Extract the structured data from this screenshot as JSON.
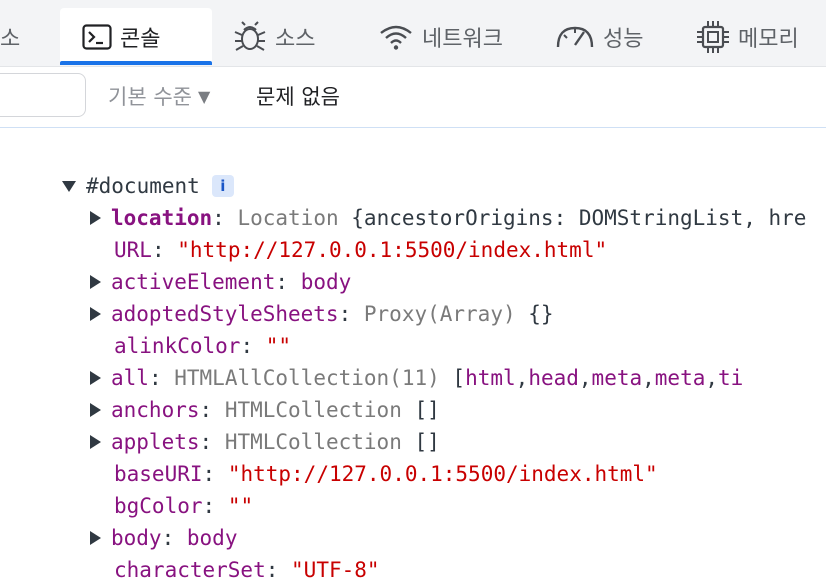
{
  "tabs": [
    {
      "label": "소",
      "icon": "sources-icon"
    },
    {
      "label": "콘솔",
      "icon": "console-icon",
      "active": true
    },
    {
      "label": "소스",
      "icon": "bug-icon"
    },
    {
      "label": "네트워크",
      "icon": "wifi-icon"
    },
    {
      "label": "성능",
      "icon": "gauge-icon"
    },
    {
      "label": "메모리",
      "icon": "chip-icon"
    }
  ],
  "filter": {
    "input_value": "",
    "level_label": "기본 수준",
    "level_caret": "▼",
    "issues_label": "문제 없음"
  },
  "tree": {
    "root": {
      "label": "#document",
      "info": "i"
    },
    "rows": [
      {
        "key": "location",
        "sep": ":",
        "type": "Location",
        "value": "{ancestorOrigins: DOMStringList, hre"
      },
      {
        "key": "URL",
        "sep": ":",
        "string": "\"http://127.0.0.1:5500/index.html\""
      },
      {
        "key": "activeElement",
        "sep": ":",
        "value": "body"
      },
      {
        "key": "adoptedStyleSheets",
        "sep": ":",
        "type": "Proxy(Array)",
        "value": "{}"
      },
      {
        "key": "alinkColor",
        "sep": ":",
        "string": "\"\""
      },
      {
        "key": "all",
        "sep": ":",
        "type": "HTMLAllCollection(11)",
        "open": "[",
        "items": [
          "html",
          "head",
          "meta",
          "meta",
          "ti"
        ]
      },
      {
        "key": "anchors",
        "sep": ":",
        "type": "HTMLCollection",
        "value": "[]"
      },
      {
        "key": "applets",
        "sep": ":",
        "type": "HTMLCollection",
        "value": "[]"
      },
      {
        "key": "baseURI",
        "sep": ":",
        "string": "\"http://127.0.0.1:5500/index.html\""
      },
      {
        "key": "bgColor",
        "sep": ":",
        "string": "\"\""
      },
      {
        "key": "body",
        "sep": ":",
        "value": "body"
      },
      {
        "key": "characterSet",
        "sep": ":",
        "string": "\"UTF-8\""
      }
    ],
    "list_sep": ", "
  },
  "colors": {
    "accent": "#1a73e8",
    "key": "#881280",
    "string": "#c80000",
    "type": "#7a7a7a"
  }
}
